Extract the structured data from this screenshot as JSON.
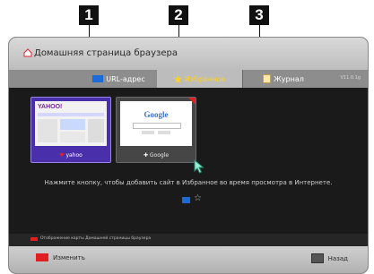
{
  "callouts": [
    "1",
    "2",
    "3"
  ],
  "header": {
    "title": "Домашняя страница браузера",
    "version": "V11.0.1g"
  },
  "tabs": [
    {
      "label": "URL-адрес",
      "icon": "url-icon",
      "active": false
    },
    {
      "label": "Избранное",
      "icon": "star-icon",
      "active": true
    },
    {
      "label": "Журнал",
      "icon": "history-icon",
      "active": false
    }
  ],
  "favorites": [
    {
      "label": "yahoo",
      "site_logo": "YAHOO!"
    },
    {
      "label": "Google",
      "site_logo": "Google"
    }
  ],
  "hint": "Нажмите кнопку, чтобы добавить сайт в Избранное во время просмотра в Интернете.",
  "footer": {
    "note": "Отображение карты Домашней страницы браузера",
    "edit_label": "Изменить",
    "back_label": "Назад"
  },
  "colors": {
    "red": "#e02020",
    "blue": "#1b6ad8",
    "active_tab": "#ffd21f",
    "selected": "#4a2faa"
  }
}
